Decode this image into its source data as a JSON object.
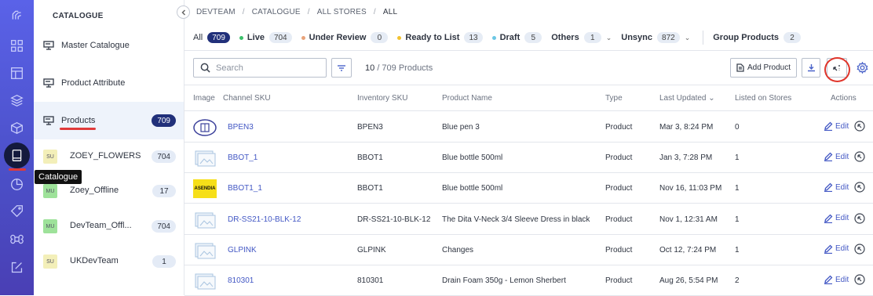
{
  "app": {
    "accent": "#21307a",
    "rail_color": "#5a62e8"
  },
  "rail": {
    "items": [
      {
        "name": "logo-icon"
      },
      {
        "name": "dashboard-grid-icon"
      },
      {
        "name": "layout-icon"
      },
      {
        "name": "layers-icon"
      },
      {
        "name": "box-icon"
      },
      {
        "name": "catalogue-book-icon",
        "active": true
      },
      {
        "name": "pie-chart-icon"
      },
      {
        "name": "tag-icon"
      },
      {
        "name": "command-icon"
      },
      {
        "name": "edit-box-icon"
      }
    ],
    "tooltip": "Catalogue"
  },
  "sidebar": {
    "title": "CATALOGUE",
    "items": [
      {
        "label": "Master Catalogue",
        "icon": "monitor-icon"
      },
      {
        "label": "Product Attribute",
        "icon": "monitor-icon"
      },
      {
        "label": "Products",
        "icon": "monitor-icon",
        "count": "709",
        "active": true
      }
    ],
    "channels": [
      {
        "badge": "SU",
        "label": "ZOEY_FLOWERS",
        "count": "704",
        "color": "#f3efb9"
      },
      {
        "badge": "MU",
        "label": "Zoey_Offline",
        "count": "17",
        "color": "#9ee29a"
      },
      {
        "badge": "MU",
        "label": "DevTeam_Offl...",
        "count": "704",
        "color": "#9ee29a"
      },
      {
        "badge": "SU",
        "label": "UKDevTeam",
        "count": "1",
        "color": "#f3efb9"
      }
    ]
  },
  "breadcrumb": [
    "DEVTEAM",
    "CATALOGUE",
    "ALL STORES",
    "ALL"
  ],
  "filters": [
    {
      "label": "All",
      "count": "709",
      "dot": null,
      "active": true
    },
    {
      "label": "Live",
      "count": "704",
      "dot": "#3cc06a"
    },
    {
      "label": "Under Review",
      "count": "0",
      "dot": "#e8a37a"
    },
    {
      "label": "Ready to List",
      "count": "13",
      "dot": "#f2c230"
    },
    {
      "label": "Draft",
      "count": "5",
      "dot": "#6cc7e4"
    },
    {
      "label": "Others",
      "count": "1",
      "dot": null,
      "dropdown": true
    },
    {
      "label": "Unsync",
      "count": "872",
      "dot": null,
      "dropdown": true
    },
    {
      "label": "Group Products",
      "count": "2",
      "dot": null,
      "divider_before": true
    }
  ],
  "toolbar": {
    "search_placeholder": "Search",
    "shown": "10",
    "total": "/ 709 Products",
    "add_product": "Add Product"
  },
  "table": {
    "columns": [
      "Image",
      "Channel SKU",
      "Inventory SKU",
      "Product Name",
      "Type",
      "Last Updated",
      "Listed on Stores",
      "Actions"
    ],
    "sort_column": "Last Updated",
    "edit_label": "Edit",
    "rows": [
      {
        "image": "pen-logo",
        "channel_sku": "BPEN3",
        "inventory_sku": "BPEN3",
        "name": "Blue pen 3",
        "type": "Product",
        "updated": "Mar 3, 8:24 PM",
        "listed": "0"
      },
      {
        "image": "placeholder",
        "channel_sku": "BBOT_1",
        "inventory_sku": "BBOT1",
        "name": "Blue bottle 500ml",
        "type": "Product",
        "updated": "Jan 3, 7:28 PM",
        "listed": "1"
      },
      {
        "image": "asendia-logo",
        "channel_sku": "BBOT1_1",
        "inventory_sku": "BBOT1",
        "name": "Blue bottle 500ml",
        "type": "Product",
        "updated": "Nov 16, 11:03 PM",
        "listed": "1"
      },
      {
        "image": "placeholder",
        "channel_sku": "DR-SS21-10-BLK-12",
        "inventory_sku": "DR-SS21-10-BLK-12",
        "name": "The Dita V-Neck 3/4 Sleeve Dress in black",
        "type": "Product",
        "updated": "Nov 1, 12:31 AM",
        "listed": "1"
      },
      {
        "image": "placeholder",
        "channel_sku": "GLPINK",
        "inventory_sku": "GLPINK",
        "name": "Changes",
        "type": "Product",
        "updated": "Oct 12, 7:24 PM",
        "listed": "1"
      },
      {
        "image": "placeholder",
        "channel_sku": "810301",
        "inventory_sku": "810301",
        "name": "Drain Foam 350g - Lemon Sherbert",
        "type": "Product",
        "updated": "Aug 26, 5:54 PM",
        "listed": "2"
      }
    ]
  },
  "logo_text": {
    "asendia": "ASENDIA"
  }
}
